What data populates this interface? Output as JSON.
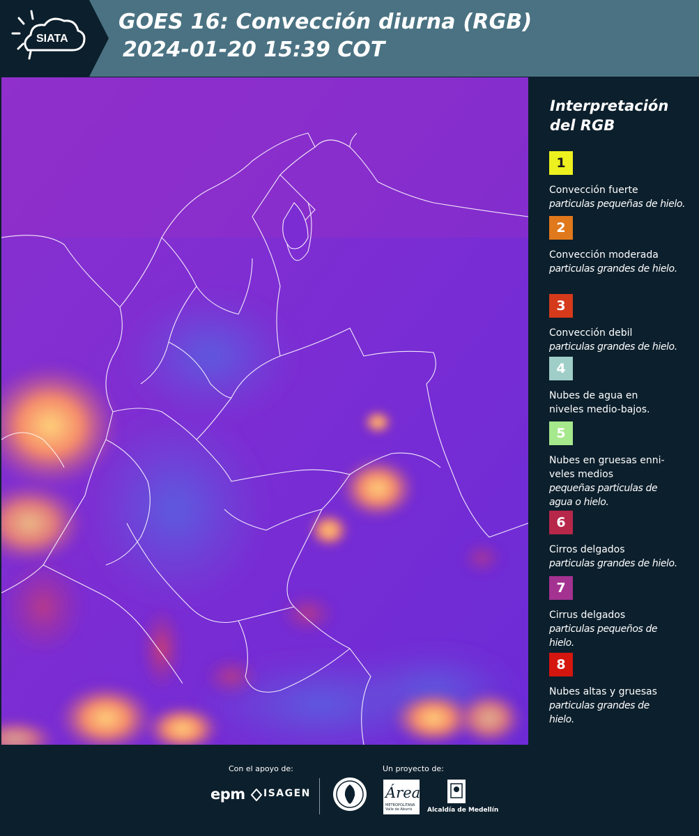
{
  "header": {
    "logo_text": "SIATA",
    "title_line1": "GOES 16: Convección diurna (RGB)",
    "title_line2": "2024-01-20 15:39 COT",
    "background_color": "#4a7282"
  },
  "legend": {
    "title": "Interpretación del RGB",
    "items": [
      {
        "number": "1",
        "color": "#ecf01e",
        "text_color": "#1a1a1a",
        "label": "Convección fuerte",
        "desc": "particulas pequeñas de hielo."
      },
      {
        "number": "2",
        "color": "#e0781c",
        "text_color": "#ffffff",
        "label": "Convección moderada",
        "desc": "particulas grandes de hielo."
      },
      {
        "number": "3",
        "color": "#d53a1b",
        "text_color": "#ffffff",
        "label": "Convección debil",
        "desc": "particulas grandes de hielo."
      },
      {
        "number": "4",
        "color": "#9fcdc8",
        "text_color": "#ffffff",
        "label": "Nubes de agua en niveles medio-bajos.",
        "desc": ""
      },
      {
        "number": "5",
        "color": "#a6e88c",
        "text_color": "#ffffff",
        "label": "Nubes en gruesas enni-veles medios",
        "desc": "pequeñas particulas de agua o hielo."
      },
      {
        "number": "6",
        "color": "#b6274a",
        "text_color": "#ffffff",
        "label": "Cirros delgados",
        "desc": "particulas grandes de hielo."
      },
      {
        "number": "7",
        "color": "#a43291",
        "text_color": "#ffffff",
        "label": "Cirrus delgados",
        "desc": "particulas pequeños de hielo."
      },
      {
        "number": "8",
        "color": "#d4160f",
        "text_color": "#ffffff",
        "label": "Nubes altas y gruesas",
        "desc": "particulas grandes de hielo."
      }
    ]
  },
  "footer": {
    "support_label": "Con el apoyo de:",
    "project_label": "Un proyecto de:",
    "sponsors": [
      "epm",
      "ISAGEN"
    ],
    "partners": [
      "Área Metropolitana Valle de Aburrá",
      "Alcaldía de Medellín"
    ],
    "area_mark": "Área",
    "area_caption": "METROPOLITANA Valle de Aburrá",
    "alcaldia_label": "Alcaldía de Medellín"
  }
}
